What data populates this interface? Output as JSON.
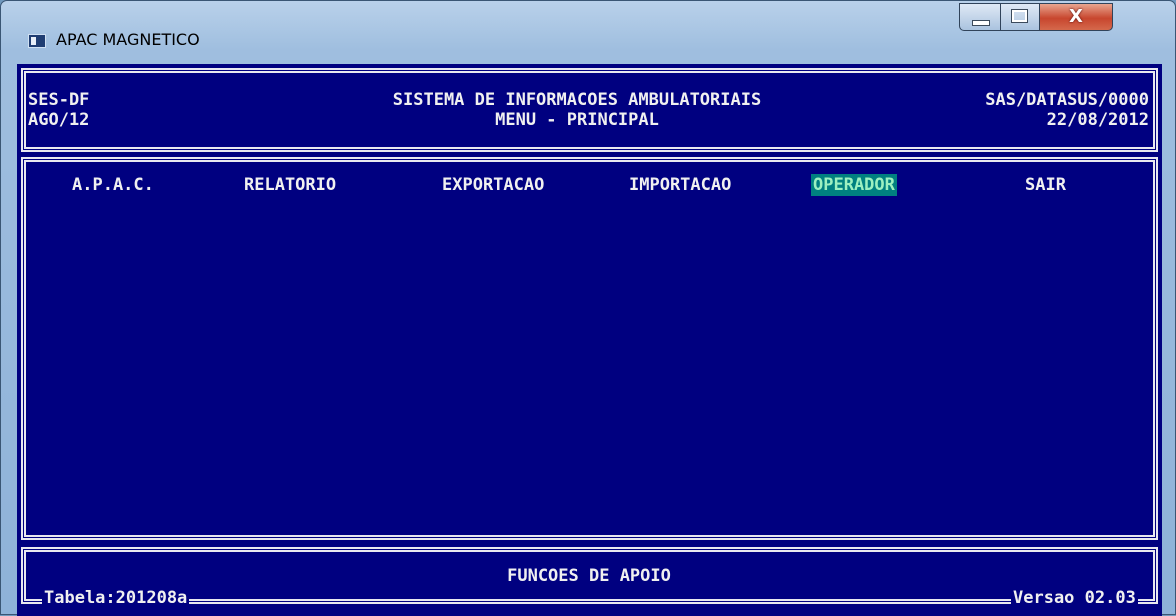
{
  "window": {
    "title": "APAC MAGNETICO",
    "close_symbol": "X"
  },
  "header": {
    "left_line1": "SES-DF",
    "left_line2": "AGO/12",
    "center_line1": "SISTEMA DE INFORMACOES AMBULATORIAIS",
    "center_line2": "MENU - PRINCIPAL",
    "right_line1": "SAS/DATASUS/0000",
    "right_line2": "22/08/2012"
  },
  "menu": {
    "items": [
      {
        "label": "A.P.A.C."
      },
      {
        "label": "RELATORIO"
      },
      {
        "label": "EXPORTACAO"
      },
      {
        "label": "IMPORTACAO"
      },
      {
        "label": "OPERADOR"
      },
      {
        "label": "SAIR"
      }
    ],
    "selected": "OPERADOR"
  },
  "footer": {
    "title": "FUNCOES DE APOIO",
    "table_label": "Tabela:201208a",
    "version_label": "Versao 02.03"
  },
  "colors": {
    "console_bg": "#000080",
    "text": "#f0f0f0",
    "highlight_bg": "#008080",
    "highlight_text": "#9cf0c0"
  }
}
